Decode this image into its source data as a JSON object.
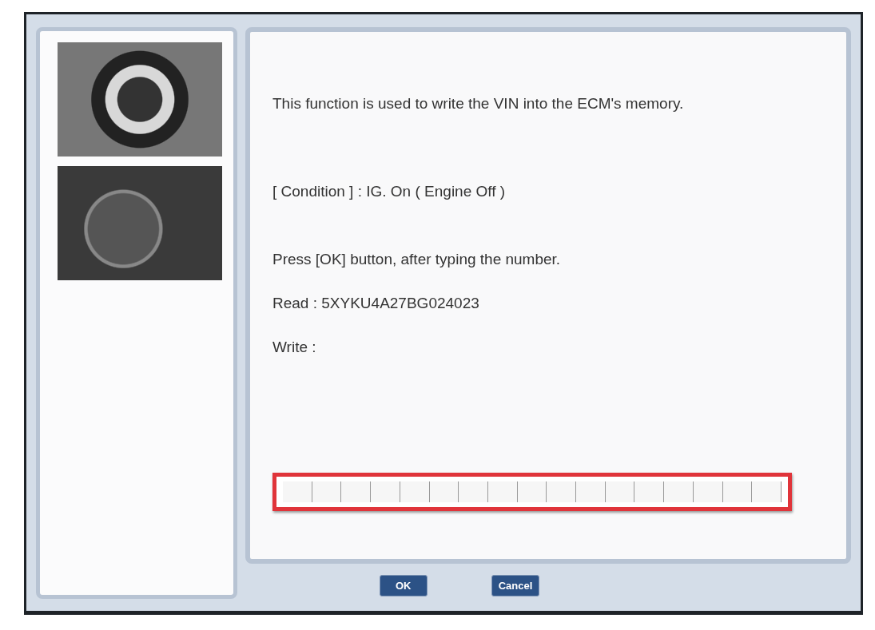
{
  "photos": [
    {
      "kind": "ignition"
    },
    {
      "kind": "gauges"
    }
  ],
  "messages": [
    {
      "text": "This function is used to write the VIN into the ECM's memory."
    },
    {
      "text": "[ Condition ] : IG. On ( Engine Off )"
    },
    {
      "text": "Press [OK] button, after typing the number."
    },
    {
      "text": "Read : 5XYKU4A27BG024023"
    },
    {
      "text": "Write :"
    }
  ],
  "vin_entry": {
    "highlighted": true
  },
  "buttons": [
    {
      "label": "OK"
    },
    {
      "label": "Cancel"
    }
  ]
}
